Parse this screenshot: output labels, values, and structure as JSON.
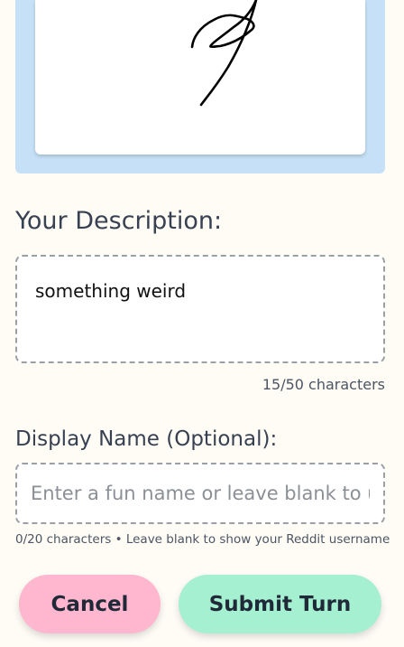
{
  "canvas": {
    "frame_color": "#c6e1f7",
    "stroke_color": "#000000"
  },
  "description": {
    "label": "Your Description:",
    "value": "something weird",
    "char_count": "15/50 characters"
  },
  "display_name": {
    "label": "Display Name (Optional):",
    "placeholder": "Enter a fun name or leave blank to use Reddit username",
    "value": "",
    "hint": "0/20 characters • Leave blank to show your Reddit username"
  },
  "actions": {
    "cancel_label": "Cancel",
    "submit_label": "Submit Turn",
    "cancel_color": "#ffb7d0",
    "submit_color": "#a6f0d2"
  }
}
